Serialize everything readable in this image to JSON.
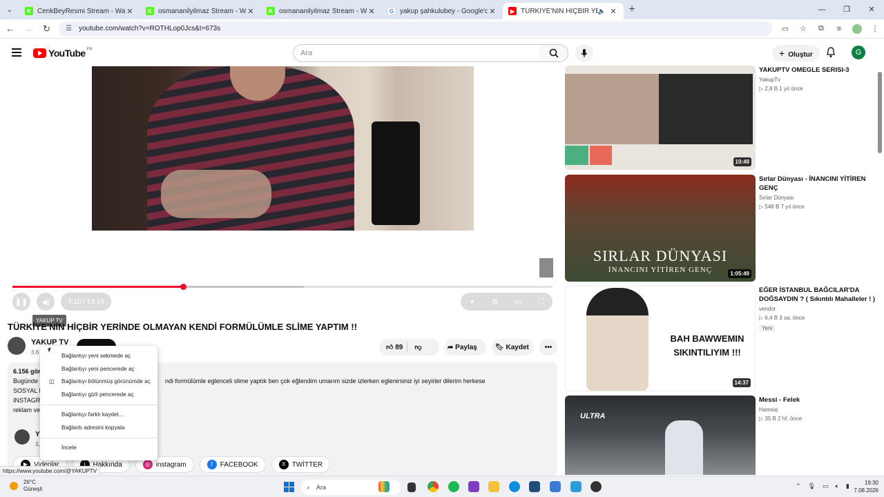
{
  "browser": {
    "tabs": [
      {
        "title": "CenkBeyResmi Stream - Watch",
        "favicon_color": "#53fc18"
      },
      {
        "title": "osmananilyilmaz Stream - Watc",
        "favicon_color": "#53fc18"
      },
      {
        "title": "osmananilyilmaz Stream - Watc",
        "favicon_color": "#53fc18"
      },
      {
        "title": "yakup şahkulubey - Google'da A",
        "favicon_color": "#4285f4"
      },
      {
        "title": "TÜRKİYE'NİN HİÇBİR YERİNDE",
        "favicon_color": "#ff0000"
      }
    ],
    "url": "youtube.com/watch?v=ROTHLop0Jcs&t=673s",
    "status_url": "https://www.youtube.com/@YAKUPTV"
  },
  "youtube": {
    "logo_text": "YouTube",
    "country_code": "FR",
    "search_placeholder": "Ara",
    "create_label": "Oluştur",
    "avatar_letter": "G"
  },
  "player": {
    "time": "4:10 / 13:14",
    "progress_fraction": 0.316,
    "buffered_fraction": 0.54,
    "tooltip": "YAKUP TV"
  },
  "video": {
    "title": "TÜRKİYE'NİN HİÇBİR YERİNDE OLMAYAN KENDİ FORMÜLÜMLE SLİME YAPTIM !!",
    "channel": "YAKUP TV",
    "subs": "3,6",
    "likes": "89",
    "share_label": "Paylaş",
    "save_label": "Kaydet",
    "views": "6.156 gör",
    "desc_line1": "Bugünde",
    "desc_line1_rest": "ndi formülümle eglenceli slime yaptık ben çok eğlendim umarım sizde izlerken eglenirsiniz iyi seyirler dilerim herkese",
    "desc_line2": "SOSYAL M",
    "desc_line3": "INSTAGR",
    "desc_line4": "reklam ve",
    "channel2_name": "Y",
    "channel2_subs": "3,",
    "chips": [
      {
        "label": "Videolar",
        "icon": "video-icon"
      },
      {
        "label": "Hakkında",
        "icon": "info-icon"
      },
      {
        "label": "instagram",
        "icon": "instagram-icon",
        "color": "#d62976"
      },
      {
        "label": "FACEBOOK",
        "icon": "facebook-icon",
        "color": "#1877f2"
      },
      {
        "label": "TWİTTER",
        "icon": "x-icon",
        "color": "#000000"
      }
    ]
  },
  "context_menu": {
    "items": [
      "Bağlantıyı yeni sekmede aç",
      "Bağlantıyı yeni pencerede aç",
      "Bağlantıyı bölünmüş görünümde aç",
      "Bağlantıyı gizli pencerede aç",
      "Bağlantıyı farklı kaydet...",
      "Bağlantı adresini kopyala",
      "İncele"
    ]
  },
  "recommendations": [
    {
      "title": "YAKUPTV OMEGLE SERISI-3",
      "channel": "YakupTv",
      "meta": "▷ 2,8 B   1 yıl önce",
      "duration": "10:49",
      "thumb_color": "#e9e4dd"
    },
    {
      "title": "Sırlar Dünyası - İNANCINI YİTİREN GENÇ",
      "channel": "Sırlar Dünyası",
      "meta": "▷ 548 B   7 yıl önce",
      "duration": "1:05:49",
      "thumb_color": "#3c4a33",
      "overlay_line1": "SIRLAR DÜNYASI",
      "overlay_line2": "İNANCINI YİTİREN GENÇ"
    },
    {
      "title": "EĞER İSTANBUL BAĞCILAR'DA DOĞSAYDIN ? ( Sıkıntılı Mahalleler ! )",
      "channel": "vendor",
      "meta": "▷ 6,4 B   3 sa. önce",
      "badge": "Yeni",
      "duration": "14:37",
      "thumb_color": "#ffffff",
      "overlay_line1": "BAH BAWWEMIN",
      "overlay_line2": "SIKINTILIYIM !!!"
    },
    {
      "title": "Messi - Felek",
      "channel": "Hamsiq",
      "meta": "▷ 35 B   2 hf. önce",
      "thumb_color": "#4a4e52",
      "overlay_line1": "ULTRA"
    }
  ],
  "taskbar": {
    "temp": "26°C",
    "weather": "Güneşli",
    "search": "Ara",
    "time": "19:30",
    "date": "7.08.2026"
  }
}
